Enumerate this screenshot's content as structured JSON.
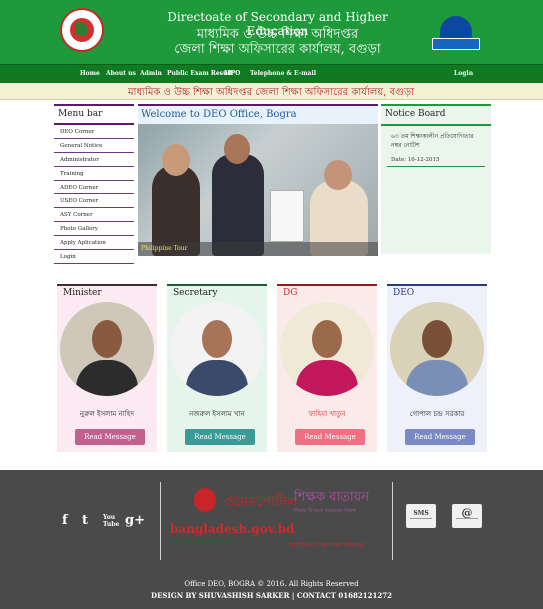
{
  "header": {
    "title_en": "Directoate of Secondary and Higher Education",
    "title_bn_1": "মাধ্যমিক ও উচ্চ শিক্ষা অধিদপ্তর",
    "title_bn_2": "জেলা শিক্ষা অফিসারের কার্যালয়, বগুড়া"
  },
  "nav": {
    "home": "Home",
    "about": "About us",
    "admin": "Admin",
    "exam": "Public Exam Result",
    "mpo": "MPO",
    "telephone": "Telephone & E-mail",
    "login": "Login"
  },
  "marquee": {
    "text": "মাধ্যমিক ও উচ্চ শিক্ষা অধিদপ্তর জেলা শিক্ষা অফিসারের কার্যালয়, বগুড়া"
  },
  "menu": {
    "title": "Menu bar",
    "items": [
      "DEO Corner",
      "General Notice",
      "Administrator",
      "Training",
      "ADEO Corner",
      "USEO Corner",
      "ASY Corner",
      "Photo Gallery",
      "Apply Aplication",
      "Login"
    ]
  },
  "welcome": {
    "title": "Welcome to DEO Office, Bogra",
    "caption": "Philippine Tour"
  },
  "notice": {
    "title": "Notice Board",
    "items": [
      {
        "text": "৬৩ তম শিক্ষাকালীন প্রতিযোগিতার নম্বর নোটিশ",
        "date": "Date: 16-12-2015"
      }
    ]
  },
  "cards": [
    {
      "role": "Minister",
      "name": "নুরুল ইসলাম নাহিদ",
      "button": "Read Message",
      "color": "#c2608e"
    },
    {
      "role": "Secretary",
      "name": "নজরুল ইসলাম খান",
      "button": "Read Message",
      "color": "#3c9a96"
    },
    {
      "role": "DG",
      "name": "ফাহিমা খাতুন",
      "button": "Read Message",
      "color": "#ef6f83"
    },
    {
      "role": "DEO",
      "name": "গোপাল চন্দ্র সরকার",
      "button": "Read Message",
      "color": "#7b8ac5"
    }
  ],
  "footer": {
    "social": [
      "f",
      "t",
      "You Tube",
      "g+"
    ],
    "brand_left_eng": "ওয়েবপোর্টাল",
    "brand_left_site": "bangladesh.gov.bd",
    "brand_left_tag": "বাংলাদেশ জাতীয় তথ্য বাতায়ন",
    "brand_mid_1": "শিক্ষক বাতায়ন",
    "brand_mid_2": "শিক্ষার উৎকর্ষে আমাদের শিক্ষক",
    "brand_mid_3": "মাধ্যমিক ও উচ্চ শিক্ষা অধিদপ্তর",
    "sms": "SMS",
    "copyright": "Office DEO, BOGRA © 2016. All Rights Reserved",
    "design": "DESIGN BY SHUVASHISH SARKER | CONTACT 01682121272"
  },
  "colors": {
    "header_green": "#1f9a3b",
    "nav_green": "#0f7a22",
    "marquee_text": "#b51f2d",
    "footer_bg": "#4a4a4a"
  }
}
